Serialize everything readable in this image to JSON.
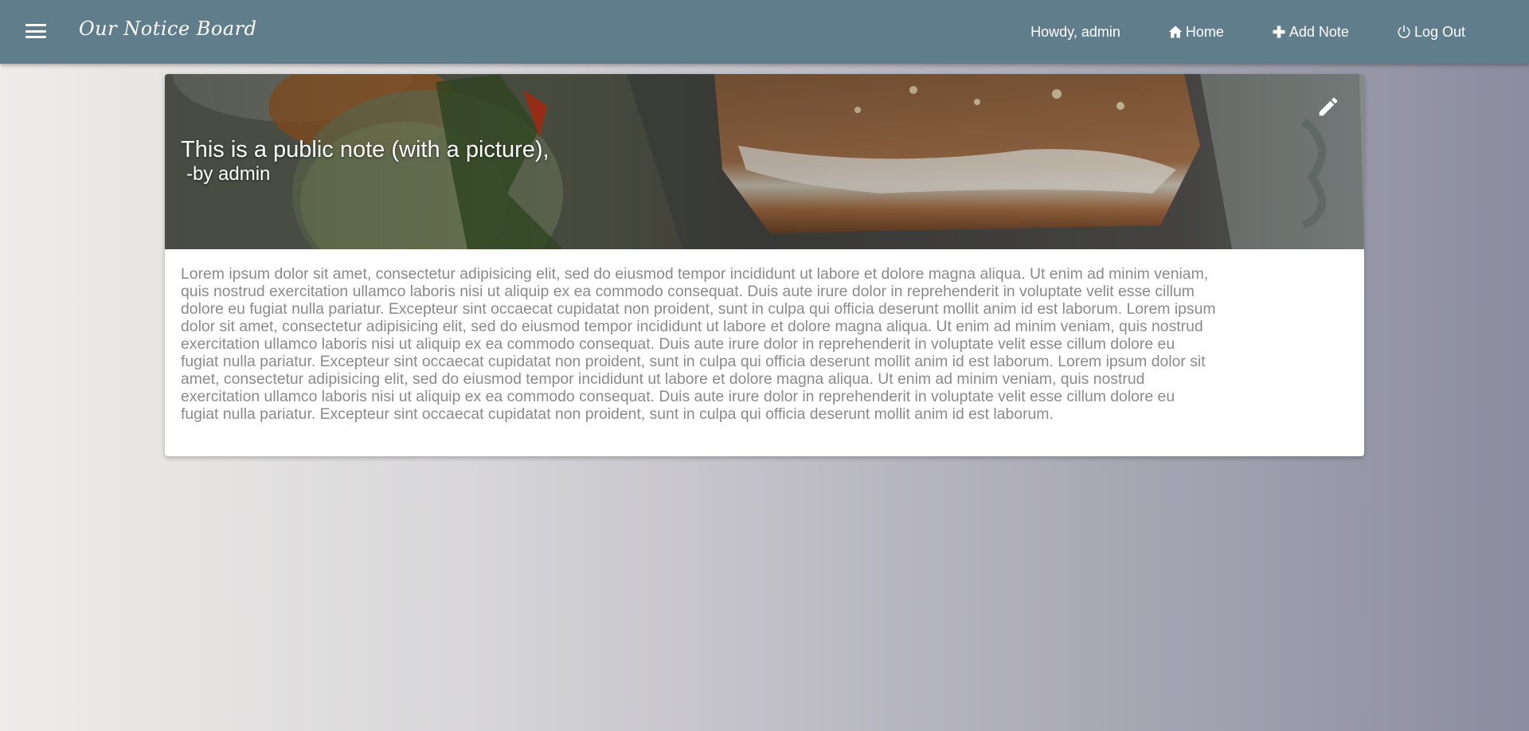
{
  "app": {
    "title": "Our Notice Board"
  },
  "nav": {
    "greeting": "Howdy, admin",
    "home_label": "Home",
    "add_note_label": "Add Note",
    "logout_label": "Log Out"
  },
  "note": {
    "title": "This is a public note (with a picture),",
    "author": "-by admin",
    "body": "Lorem ipsum dolor sit amet, consectetur adipisicing elit, sed do eiusmod tempor incididunt ut labore et dolore magna aliqua. Ut enim ad minim veniam, quis nostrud exercitation ullamco laboris nisi ut aliquip ex ea commodo consequat. Duis aute irure dolor in reprehenderit in voluptate velit esse cillum dolore eu fugiat nulla pariatur. Excepteur sint occaecat cupidatat non proident, sunt in culpa qui officia deserunt mollit anim id est laborum. Lorem ipsum dolor sit amet, consectetur adipisicing elit, sed do eiusmod tempor incididunt ut labore et dolore magna aliqua. Ut enim ad minim veniam, quis nostrud exercitation ullamco laboris nisi ut aliquip ex ea commodo consequat. Duis aute irure dolor in reprehenderit in voluptate velit esse cillum dolore eu fugiat nulla pariatur. Excepteur sint occaecat cupidatat non proident, sunt in culpa qui officia deserunt mollit anim id est laborum. Lorem ipsum dolor sit amet, consectetur adipisicing elit, sed do eiusmod tempor incididunt ut labore et dolore magna aliqua. Ut enim ad minim veniam, quis nostrud exercitation ullamco laboris nisi ut aliquip ex ea commodo consequat. Duis aute irure dolor in reprehenderit in voluptate velit esse cillum dolore eu fugiat nulla pariatur. Excepteur sint occaecat cupidatat non proident, sunt in culpa qui officia deserunt mollit anim id est laborum."
  },
  "icons": {
    "menu": "menu-icon",
    "home": "home-icon",
    "add": "plus-icon",
    "logout": "power-icon",
    "edit": "pencil-icon"
  },
  "colors": {
    "topbar": "#607d8b",
    "card": "#ffffff",
    "body_text": "#8a8a8a"
  }
}
